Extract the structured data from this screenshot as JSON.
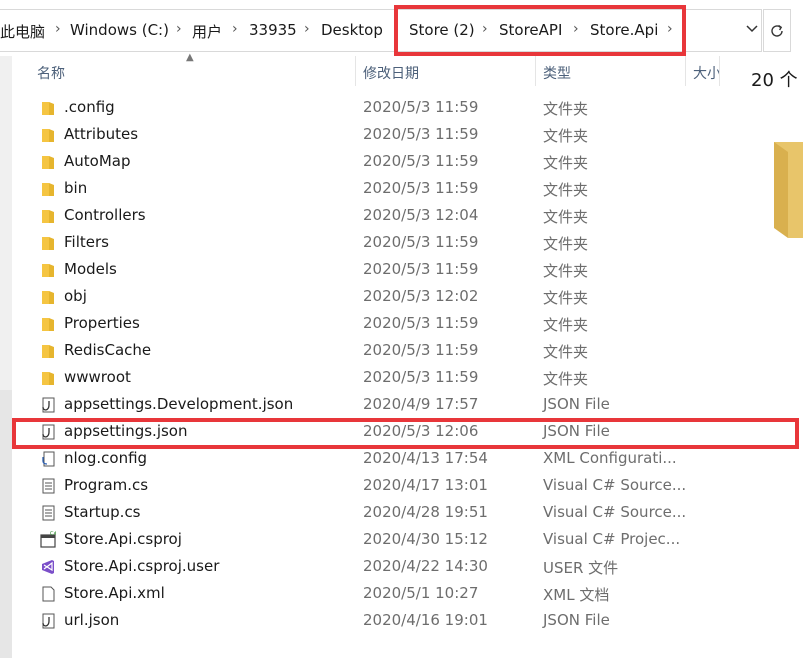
{
  "breadcrumb": {
    "items": [
      "此电脑",
      "Windows (C:)",
      "用户",
      "33935",
      "Desktop",
      "Store (2)",
      "StoreAPI",
      "Store.Api"
    ],
    "separator": "›"
  },
  "columns": {
    "name": "名称",
    "date": "修改日期",
    "type": "类型",
    "size": "大小"
  },
  "files": [
    {
      "name": ".config",
      "date": "2020/5/3 11:59",
      "type": "文件夹",
      "icon": "folder-icon"
    },
    {
      "name": "Attributes",
      "date": "2020/5/3 11:59",
      "type": "文件夹",
      "icon": "folder-icon"
    },
    {
      "name": "AutoMap",
      "date": "2020/5/3 11:59",
      "type": "文件夹",
      "icon": "folder-icon"
    },
    {
      "name": "bin",
      "date": "2020/5/3 11:59",
      "type": "文件夹",
      "icon": "folder-icon"
    },
    {
      "name": "Controllers",
      "date": "2020/5/3 12:04",
      "type": "文件夹",
      "icon": "folder-icon"
    },
    {
      "name": "Filters",
      "date": "2020/5/3 11:59",
      "type": "文件夹",
      "icon": "folder-icon"
    },
    {
      "name": "Models",
      "date": "2020/5/3 11:59",
      "type": "文件夹",
      "icon": "folder-icon"
    },
    {
      "name": "obj",
      "date": "2020/5/3 12:02",
      "type": "文件夹",
      "icon": "folder-icon"
    },
    {
      "name": "Properties",
      "date": "2020/5/3 11:59",
      "type": "文件夹",
      "icon": "folder-icon"
    },
    {
      "name": "RedisCache",
      "date": "2020/5/3 11:59",
      "type": "文件夹",
      "icon": "folder-icon"
    },
    {
      "name": "wwwroot",
      "date": "2020/5/3 11:59",
      "type": "文件夹",
      "icon": "folder-icon"
    },
    {
      "name": "appsettings.Development.json",
      "date": "2020/4/9 17:57",
      "type": "JSON File",
      "icon": "json-file-icon"
    },
    {
      "name": "appsettings.json",
      "date": "2020/5/3 12:06",
      "type": "JSON File",
      "icon": "json-file-icon"
    },
    {
      "name": "nlog.config",
      "date": "2020/4/13 17:54",
      "type": "XML Configurati...",
      "icon": "config-file-icon"
    },
    {
      "name": "Program.cs",
      "date": "2020/4/17 13:01",
      "type": "Visual C# Source...",
      "icon": "cs-file-icon"
    },
    {
      "name": "Startup.cs",
      "date": "2020/4/28 19:51",
      "type": "Visual C# Source...",
      "icon": "cs-file-icon"
    },
    {
      "name": "Store.Api.csproj",
      "date": "2020/4/30 15:12",
      "type": "Visual C# Projec...",
      "icon": "csproj-file-icon"
    },
    {
      "name": "Store.Api.csproj.user",
      "date": "2020/4/22 14:30",
      "type": "USER 文件",
      "icon": "visual-studio-icon"
    },
    {
      "name": "Store.Api.xml",
      "date": "2020/5/1 10:27",
      "type": "XML 文档",
      "icon": "blank-file-icon"
    },
    {
      "name": "url.json",
      "date": "2020/4/16 19:01",
      "type": "JSON File",
      "icon": "json-file-icon"
    }
  ],
  "details": {
    "count_text": "20 个"
  },
  "colors": {
    "highlight": "#e8363a",
    "folder": "#f5c542",
    "header_text": "#4c607a",
    "secondary_text": "#6d6d6d"
  }
}
